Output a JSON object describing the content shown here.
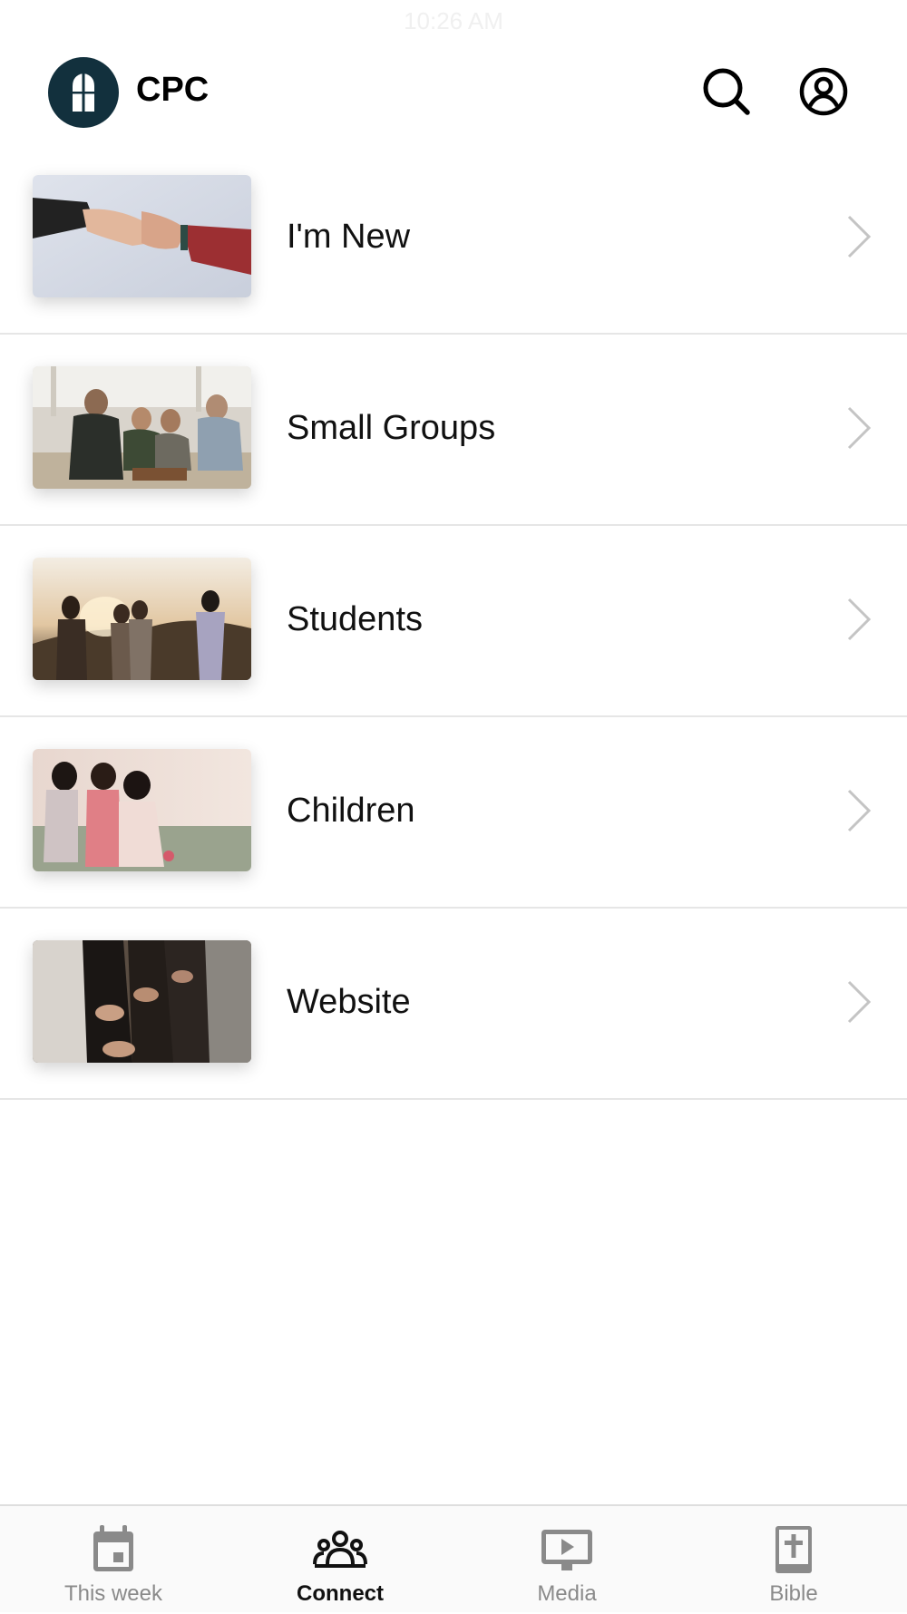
{
  "status_bar": {
    "time": "10:26 AM"
  },
  "header": {
    "title": "CPC",
    "logo_icon": "church-door-icon",
    "search_icon": "search-icon",
    "profile_icon": "account-circle-icon"
  },
  "connect_items": [
    {
      "label": "I'm New",
      "image": "handshake-photo"
    },
    {
      "label": "Small Groups",
      "image": "group-sitting-photo"
    },
    {
      "label": "Students",
      "image": "sunset-friends-photo"
    },
    {
      "label": "Children",
      "image": "kids-outdoors-photo"
    },
    {
      "label": "Website",
      "image": "worship-hands-photo"
    }
  ],
  "tabs": [
    {
      "label": "This week",
      "icon": "calendar-icon",
      "active": false
    },
    {
      "label": "Connect",
      "icon": "people-group-icon",
      "active": true
    },
    {
      "label": "Media",
      "icon": "play-screen-icon",
      "active": false
    },
    {
      "label": "Bible",
      "icon": "bible-cross-icon",
      "active": false
    }
  ],
  "colors": {
    "brand": "#12303d",
    "tab_inactive": "#8a8a8a",
    "tab_active": "#111111",
    "divider": "#e6e6e6"
  }
}
